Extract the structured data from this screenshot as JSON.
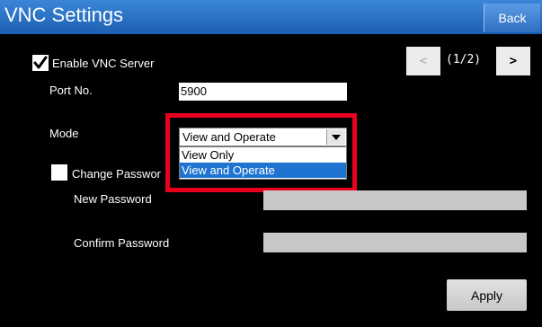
{
  "header": {
    "title": "VNC Settings",
    "back_label": "Back"
  },
  "pager": {
    "prev_label": "<",
    "next_label": ">",
    "page_indicator": "(1/2)"
  },
  "vnc": {
    "enable_label": "Enable VNC Server",
    "enable_checked": true,
    "port_label": "Port No.",
    "port_value": "5900",
    "mode_label": "Mode",
    "mode_value": "View and Operate",
    "mode_options": [
      "View Only",
      "View and Operate"
    ]
  },
  "password": {
    "change_label": "Change Passwor",
    "change_checked": false,
    "new_label": "New Password",
    "confirm_label": "Confirm Password"
  },
  "actions": {
    "apply_label": "Apply"
  },
  "colors": {
    "title_bar": "#1c5fb2",
    "highlight_frame": "#e8001e",
    "selected_option": "#1f74d2"
  }
}
